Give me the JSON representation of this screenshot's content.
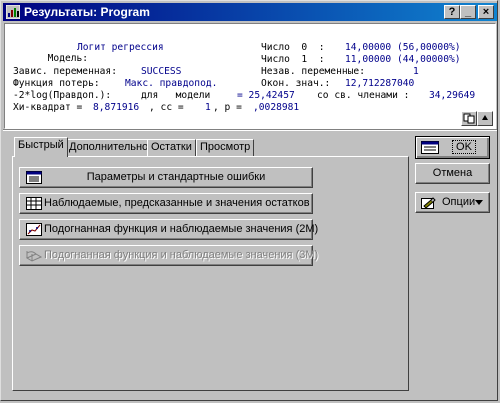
{
  "window": {
    "title": "Результаты: Program"
  },
  "titlebar_buttons": {
    "help": "?",
    "minimize": "_",
    "close": "×"
  },
  "output": {
    "model_key": "Модель:",
    "model_value": "Логит регрессия",
    "n0_key": "Число  0  :",
    "n0_value": "14,00000 (56,00000%)",
    "n1_key": "Число  1  :",
    "n1_value": "11,00000 (44,00000%)",
    "dep_key": "Завис. переменная:",
    "dep_value": "SUCCESS",
    "indep_key": "Незав. переменные:",
    "indep_value": "1",
    "loss_key": "Функция потерь:",
    "loss_value": "Макс. правдопод.",
    "final_key": "Окон. знач.:",
    "final_value": "12,712287040",
    "ll_key": "-2*log(Правдоп.):",
    "ll_model_key": "для   модели",
    "ll_model_value": "= 25,42457",
    "ll_free_key": "со св. членами :",
    "ll_free_value": "34,29649",
    "chi_key": "Хи-квадрат =",
    "chi_value": "8,871916",
    "df_key": ", сс =",
    "df_value": "1",
    "p_key": ", p =",
    "p_value": ",0028981"
  },
  "tabs": [
    {
      "label": "Быстрый",
      "active": true
    },
    {
      "label": "Дополнительно",
      "active": false
    },
    {
      "label": "Остатки",
      "active": false
    },
    {
      "label": "Просмотр",
      "active": false
    }
  ],
  "actions": {
    "params": "Параметры и стандартные ошибки",
    "observed": "Наблюдаемые, предсказанные и значения остатков",
    "fitted2m": "Подогнанная функция и наблюдаемые значения (2М)",
    "fitted3m": "Подогнанная функция и наблюдаемые значения (3М)"
  },
  "right_buttons": {
    "ok": "OK",
    "cancel": "Отмена",
    "options": "Опции"
  },
  "colors": {
    "title_start": "#000080",
    "title_end": "#1084d0",
    "value_text": "#00008b",
    "face": "#c0c0c0"
  }
}
